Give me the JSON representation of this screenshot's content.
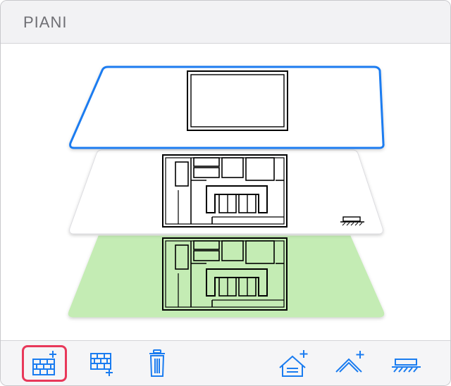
{
  "panel": {
    "title": "PIANI"
  },
  "floors": [
    {
      "name": "floor-top",
      "selected": true,
      "fill": "#ffffff",
      "border": "#1a7cf0"
    },
    {
      "name": "floor-middle",
      "selected": false,
      "fill": "#ffffff",
      "border": "#d8d8dc",
      "has_ground_symbol": true
    },
    {
      "name": "floor-bottom",
      "selected": false,
      "fill": "#c4ecb4",
      "border": "#c4ecb4"
    }
  ],
  "toolbar": {
    "items": [
      {
        "name": "add-floor-button",
        "icon": "brick-wall-plus-icon",
        "active": true
      },
      {
        "name": "duplicate-floor-button",
        "icon": "brick-wall-plus-small-icon",
        "active": false
      },
      {
        "name": "delete-floor-button",
        "icon": "trash-icon",
        "active": false
      },
      {
        "name": "add-roof-house-button",
        "icon": "house-plus-icon",
        "active": false
      },
      {
        "name": "add-roof-button",
        "icon": "roof-plus-icon",
        "active": false
      },
      {
        "name": "add-ground-button",
        "icon": "ground-slab-icon",
        "active": false
      }
    ]
  },
  "colors": {
    "accent": "#1a7cf0",
    "active_outline": "#e8385a",
    "ground_floor": "#c4ecb4"
  }
}
